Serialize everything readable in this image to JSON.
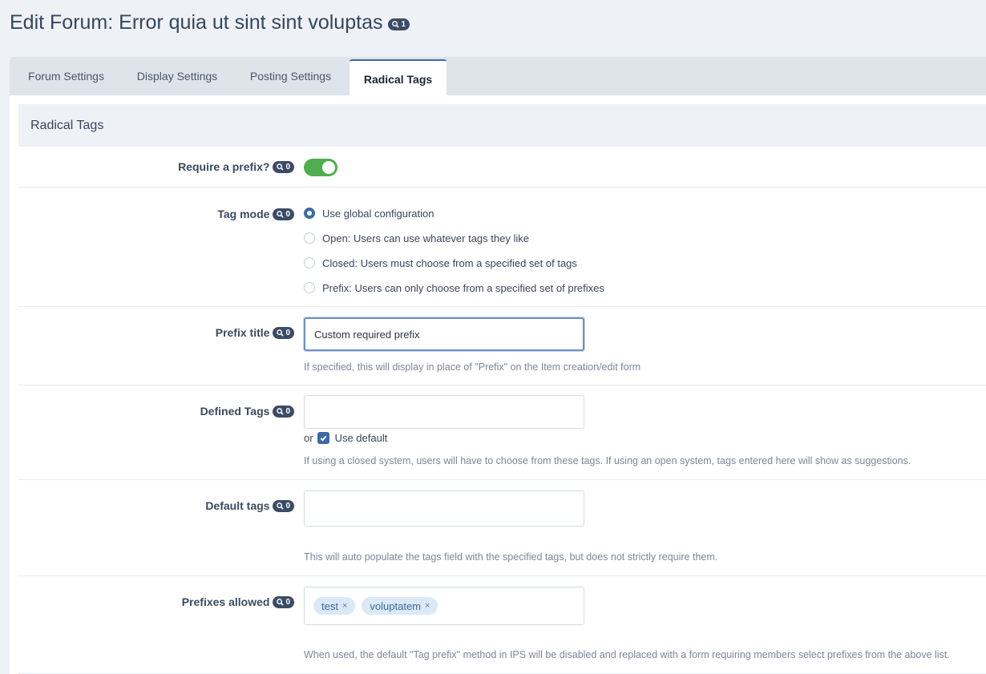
{
  "page": {
    "title": "Edit Forum: Error quia ut sint sint voluptas",
    "title_badge": "1"
  },
  "tabs": [
    {
      "label": "Forum Settings"
    },
    {
      "label": "Display Settings"
    },
    {
      "label": "Posting Settings"
    },
    {
      "label": "Radical Tags",
      "active": true
    }
  ],
  "section": {
    "title": "Radical Tags"
  },
  "fields": {
    "require_prefix": {
      "label": "Require a prefix?",
      "badge": "0",
      "enabled": true
    },
    "tag_mode": {
      "label": "Tag mode",
      "badge": "0",
      "options": [
        "Use global configuration",
        "Open: Users can use whatever tags they like",
        "Closed: Users must choose from a specified set of tags",
        "Prefix: Users can only choose from a specified set of prefixes"
      ],
      "selected": "Use global configuration"
    },
    "prefix_title": {
      "label": "Prefix title",
      "badge": "0",
      "value": "Custom required prefix",
      "description": "If specified, this will display in place of \"Prefix\" on the Item creation/edit form"
    },
    "defined_tags": {
      "label": "Defined Tags",
      "badge": "0",
      "value": "",
      "or_text": "or",
      "use_default_label": "Use default",
      "use_default_checked": true,
      "description": "If using a closed system, users will have to choose from these tags. If using an open system, tags entered here will show as suggestions."
    },
    "default_tags": {
      "label": "Default tags",
      "badge": "0",
      "value": "",
      "description": "This will auto populate the tags field with the specified tags, but does not strictly require them."
    },
    "prefixes_allowed": {
      "label": "Prefixes allowed",
      "badge": "0",
      "tags": [
        "test",
        "voluptatem"
      ],
      "remove_glyph": "×",
      "description": "When used, the default \"Tag prefix\" method in IPS will be disabled and replaced with a form requiring members select prefixes from the above list."
    }
  },
  "colors": {
    "accent": "#3c6aa8",
    "toggle_on": "#4fae4e",
    "badge_bg": "#3c4b66",
    "tag_bg": "#dbe8f5"
  }
}
